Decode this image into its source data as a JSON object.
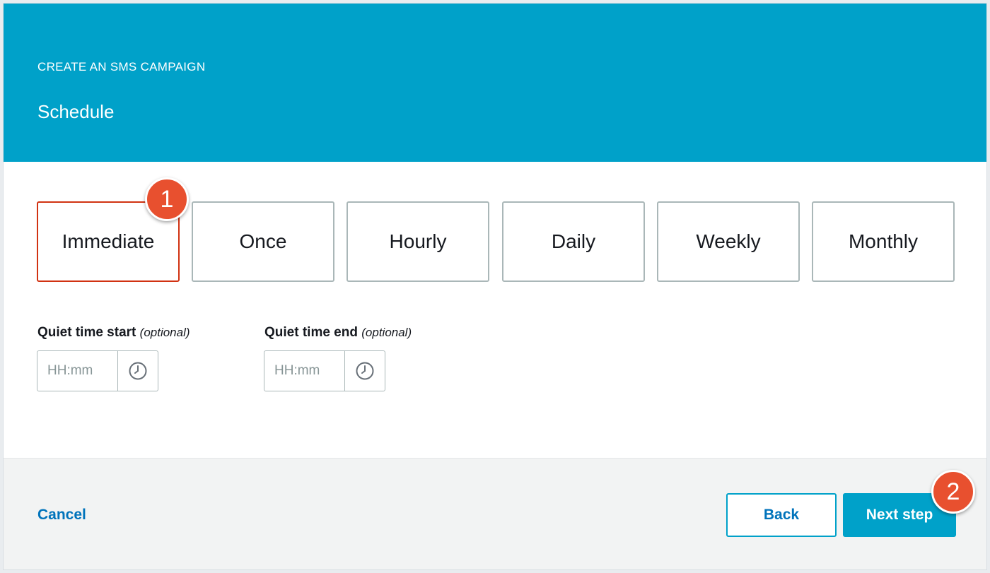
{
  "header": {
    "eyebrow": "CREATE AN SMS CAMPAIGN",
    "title": "Schedule",
    "background_color": "#00a1c9"
  },
  "schedule_options": {
    "selected": "Immediate",
    "items": [
      {
        "label": "Immediate"
      },
      {
        "label": "Once"
      },
      {
        "label": "Hourly"
      },
      {
        "label": "Daily"
      },
      {
        "label": "Weekly"
      },
      {
        "label": "Monthly"
      }
    ]
  },
  "callouts": {
    "first": "1",
    "second": "2",
    "color": "#e8502f"
  },
  "quiet_time": {
    "start": {
      "label": "Quiet time start",
      "optional": "(optional)",
      "placeholder": "HH:mm",
      "value": "",
      "icon": "clock-icon"
    },
    "end": {
      "label": "Quiet time end",
      "optional": "(optional)",
      "placeholder": "HH:mm",
      "value": "",
      "icon": "clock-icon"
    }
  },
  "footer": {
    "cancel_label": "Cancel",
    "back_label": "Back",
    "next_label": "Next step",
    "link_color": "#0073bb",
    "primary_color": "#00a1c9"
  }
}
